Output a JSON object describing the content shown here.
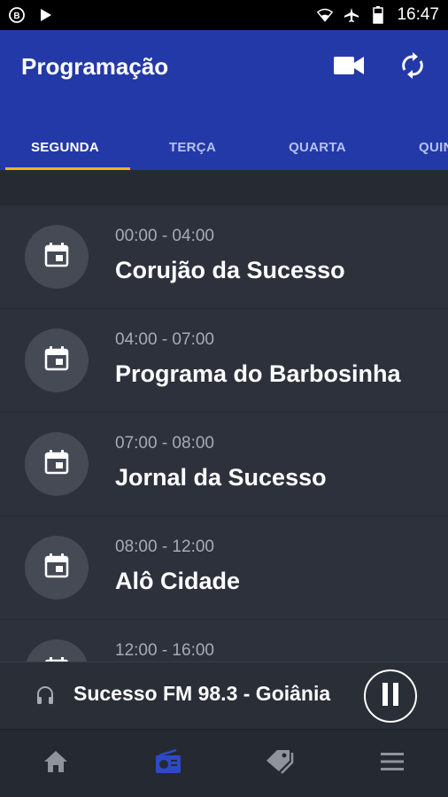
{
  "status_bar": {
    "time": "16:47"
  },
  "app_bar": {
    "title": "Programação",
    "actions": [
      "video-camera-icon",
      "refresh-icon"
    ]
  },
  "tabs": [
    {
      "label": "SEGUNDA",
      "active": true
    },
    {
      "label": "TERÇA",
      "active": false
    },
    {
      "label": "QUARTA",
      "active": false
    },
    {
      "label": "QUIN",
      "active": false
    }
  ],
  "schedule": [
    {
      "time": "00:00 - 04:00",
      "program": "Corujão da Sucesso"
    },
    {
      "time": "04:00 - 07:00",
      "program": "Programa do Barbosinha"
    },
    {
      "time": "07:00 - 08:00",
      "program": "Jornal da Sucesso"
    },
    {
      "time": "08:00 - 12:00",
      "program": "Alô Cidade"
    },
    {
      "time": "12:00 - 16:00",
      "program": ""
    }
  ],
  "player": {
    "station": "Sucesso FM 98.3 - Goiânia",
    "state_icon": "pause-icon"
  },
  "bottom_nav": [
    "home-icon",
    "radio-icon",
    "tags-icon",
    "menu-icon"
  ],
  "colors": {
    "appbar": "#2439a8",
    "tab_indicator": "#f0b21c",
    "active_nav": "#2e49c8",
    "background": "#2d313b"
  }
}
